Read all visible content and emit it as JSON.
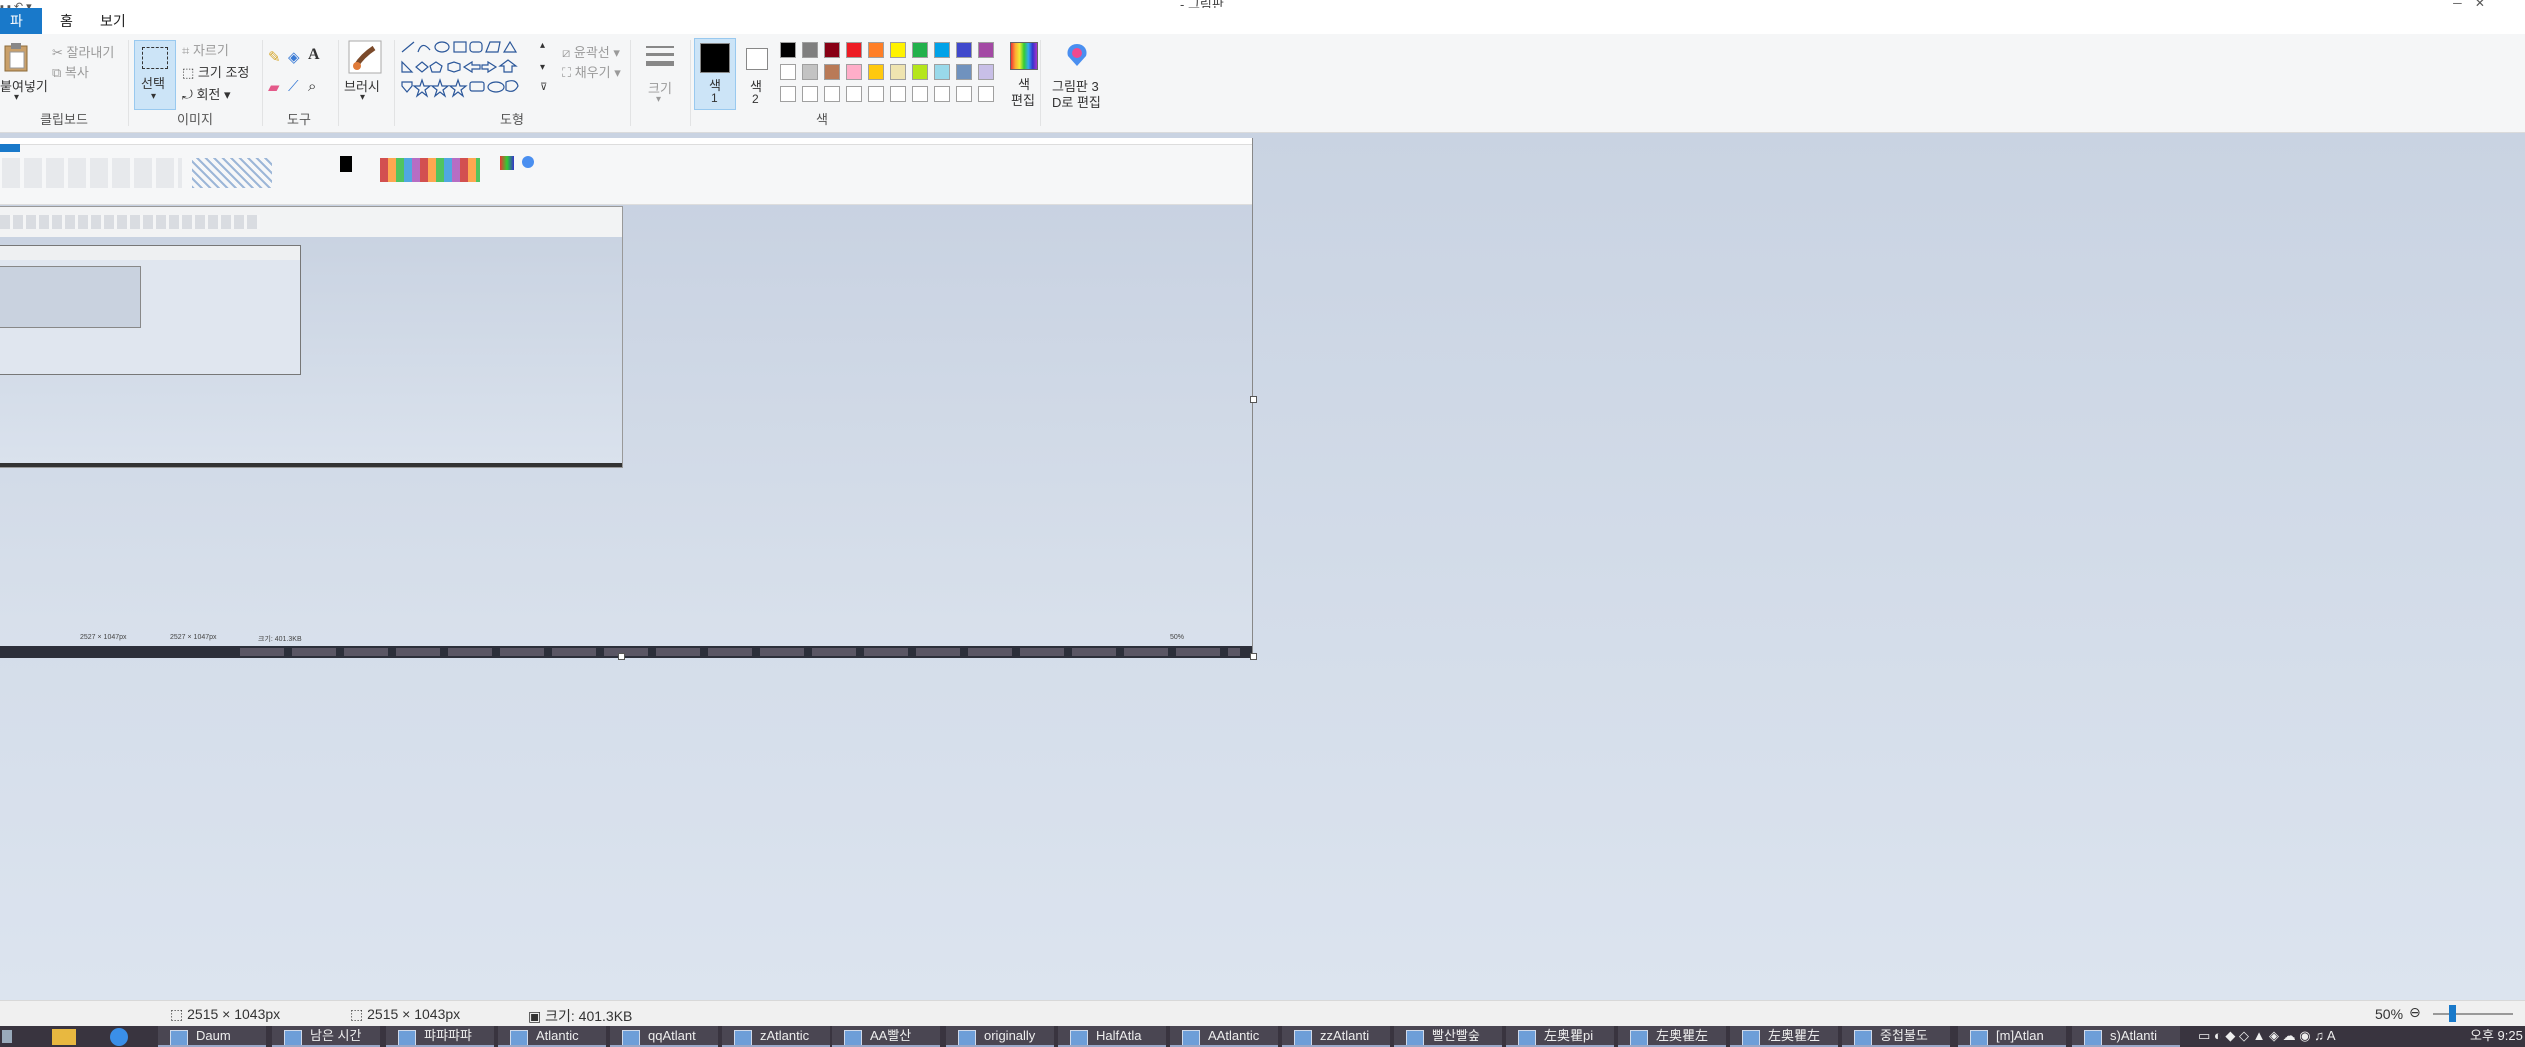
{
  "window": {
    "title": "- 그림판"
  },
  "tabs": {
    "file": "파일",
    "home": "홈",
    "view": "보기"
  },
  "clipboard": {
    "paste": "붙여넣기",
    "cut": "잘라내기",
    "copy": "복사",
    "label": "클립보드"
  },
  "image": {
    "select": "선택",
    "crop": "자르기",
    "resize": "크기 조정",
    "rotate": "회전",
    "label": "이미지"
  },
  "tools": {
    "label": "도구"
  },
  "brushes": {
    "label": "브러시"
  },
  "shapes": {
    "outline": "윤곽선",
    "fill": "채우기",
    "label": "도형"
  },
  "size": {
    "label": "크기"
  },
  "colors": {
    "color1": "색\n1",
    "color1_a": "색",
    "color1_b": "1",
    "color2_a": "색",
    "color2_b": "2",
    "edit_a": "색",
    "edit_b": "편집",
    "paint3d_a": "그림판 3",
    "paint3d_b": "D로 편집",
    "label": "색",
    "palette_row1": [
      "#000000",
      "#7f7f7f",
      "#880015",
      "#ed1c24",
      "#ff7f27",
      "#fff200",
      "#22b14c",
      "#00a2e8",
      "#3f48cc",
      "#a349a4"
    ],
    "palette_row2": [
      "#ffffff",
      "#c3c3c3",
      "#b97a57",
      "#ffaec9",
      "#ffc90e",
      "#efe4b0",
      "#b5e61d",
      "#99d9ea",
      "#7092be",
      "#c8bfe7"
    ]
  },
  "nested": {
    "status1": "2527 × 1047px",
    "status2": "2527 × 1047px",
    "status3": "크기: 401.3KB",
    "zoom": "50%"
  },
  "status": {
    "selection_size": "2515 × 1043px",
    "image_size": "2515 × 1043px",
    "file_size": "크기: 401.3KB",
    "zoom": "50%"
  },
  "taskbar": {
    "items": [
      "Daum",
      "남은 시간",
      "퍄퍄퍄퍄",
      "Atlantic",
      "qqAtlant",
      "zAtlantic",
      "AA빨산",
      "originally",
      "HalfAtla",
      "AAtlantic",
      "zzAtlanti",
      "빨산빨숲",
      "左奥瞿pi",
      "左奥瞿左",
      "左奥瞿左",
      "중첩불도",
      "[m]Atlan",
      "s)Atlanti"
    ],
    "clock": "오후 9:25",
    "tray_text": "A"
  }
}
